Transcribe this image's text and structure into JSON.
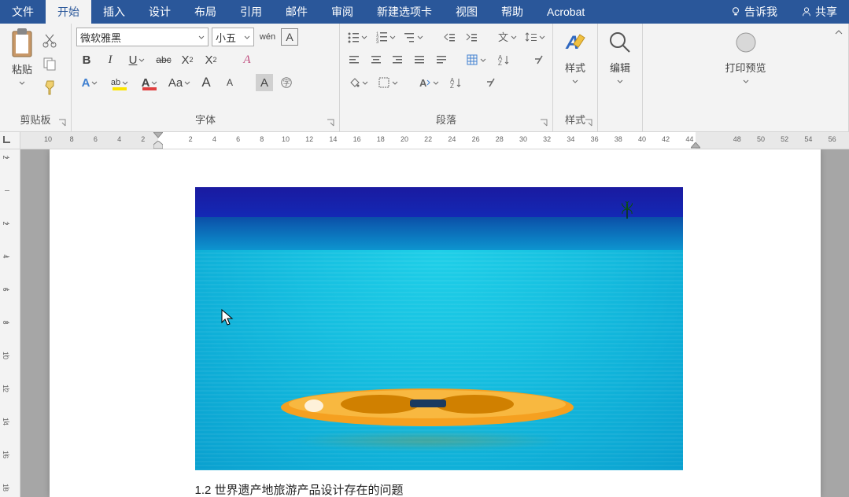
{
  "menu": {
    "file": "文件",
    "home": "开始",
    "insert": "插入",
    "design": "设计",
    "layout": "布局",
    "references": "引用",
    "mail": "邮件",
    "review": "审阅",
    "newtab": "新建选项卡",
    "view": "视图",
    "help": "帮助",
    "acrobat": "Acrobat",
    "tellme": "告诉我",
    "share": "共享"
  },
  "ribbon": {
    "clipboard": {
      "paste": "粘贴",
      "label": "剪贴板"
    },
    "font": {
      "name": "微软雅黑",
      "size": "小五",
      "pinyin": "wén",
      "bold": "B",
      "italic": "I",
      "underline": "U",
      "strike": "abc",
      "sub": "X",
      "sup": "X",
      "clear": "A",
      "effects": "A",
      "aa": "Aa",
      "grow": "A",
      "shrink": "A",
      "case": "A",
      "label": "字体"
    },
    "paragraph": {
      "label": "段落"
    },
    "styles": {
      "btn": "样式",
      "label": "样式"
    },
    "editing": {
      "btn": "编辑"
    },
    "preview": {
      "btn": "打印预览"
    }
  },
  "ruler": {
    "h": [
      "10",
      "8",
      "6",
      "4",
      "2",
      "",
      "2",
      "4",
      "6",
      "8",
      "10",
      "12",
      "14",
      "16",
      "18",
      "20",
      "22",
      "24",
      "26",
      "28",
      "30",
      "32",
      "34",
      "36",
      "38",
      "40",
      "42",
      "44",
      "",
      "48",
      "50",
      "52",
      "54",
      "56"
    ]
  },
  "vruler": [
    "2",
    "",
    "2",
    "4",
    "6",
    "8",
    "10",
    "12",
    "14",
    "16",
    "18"
  ],
  "doc": {
    "heading": "1.2 世界遗产地旅游产品设计存在的问题"
  }
}
